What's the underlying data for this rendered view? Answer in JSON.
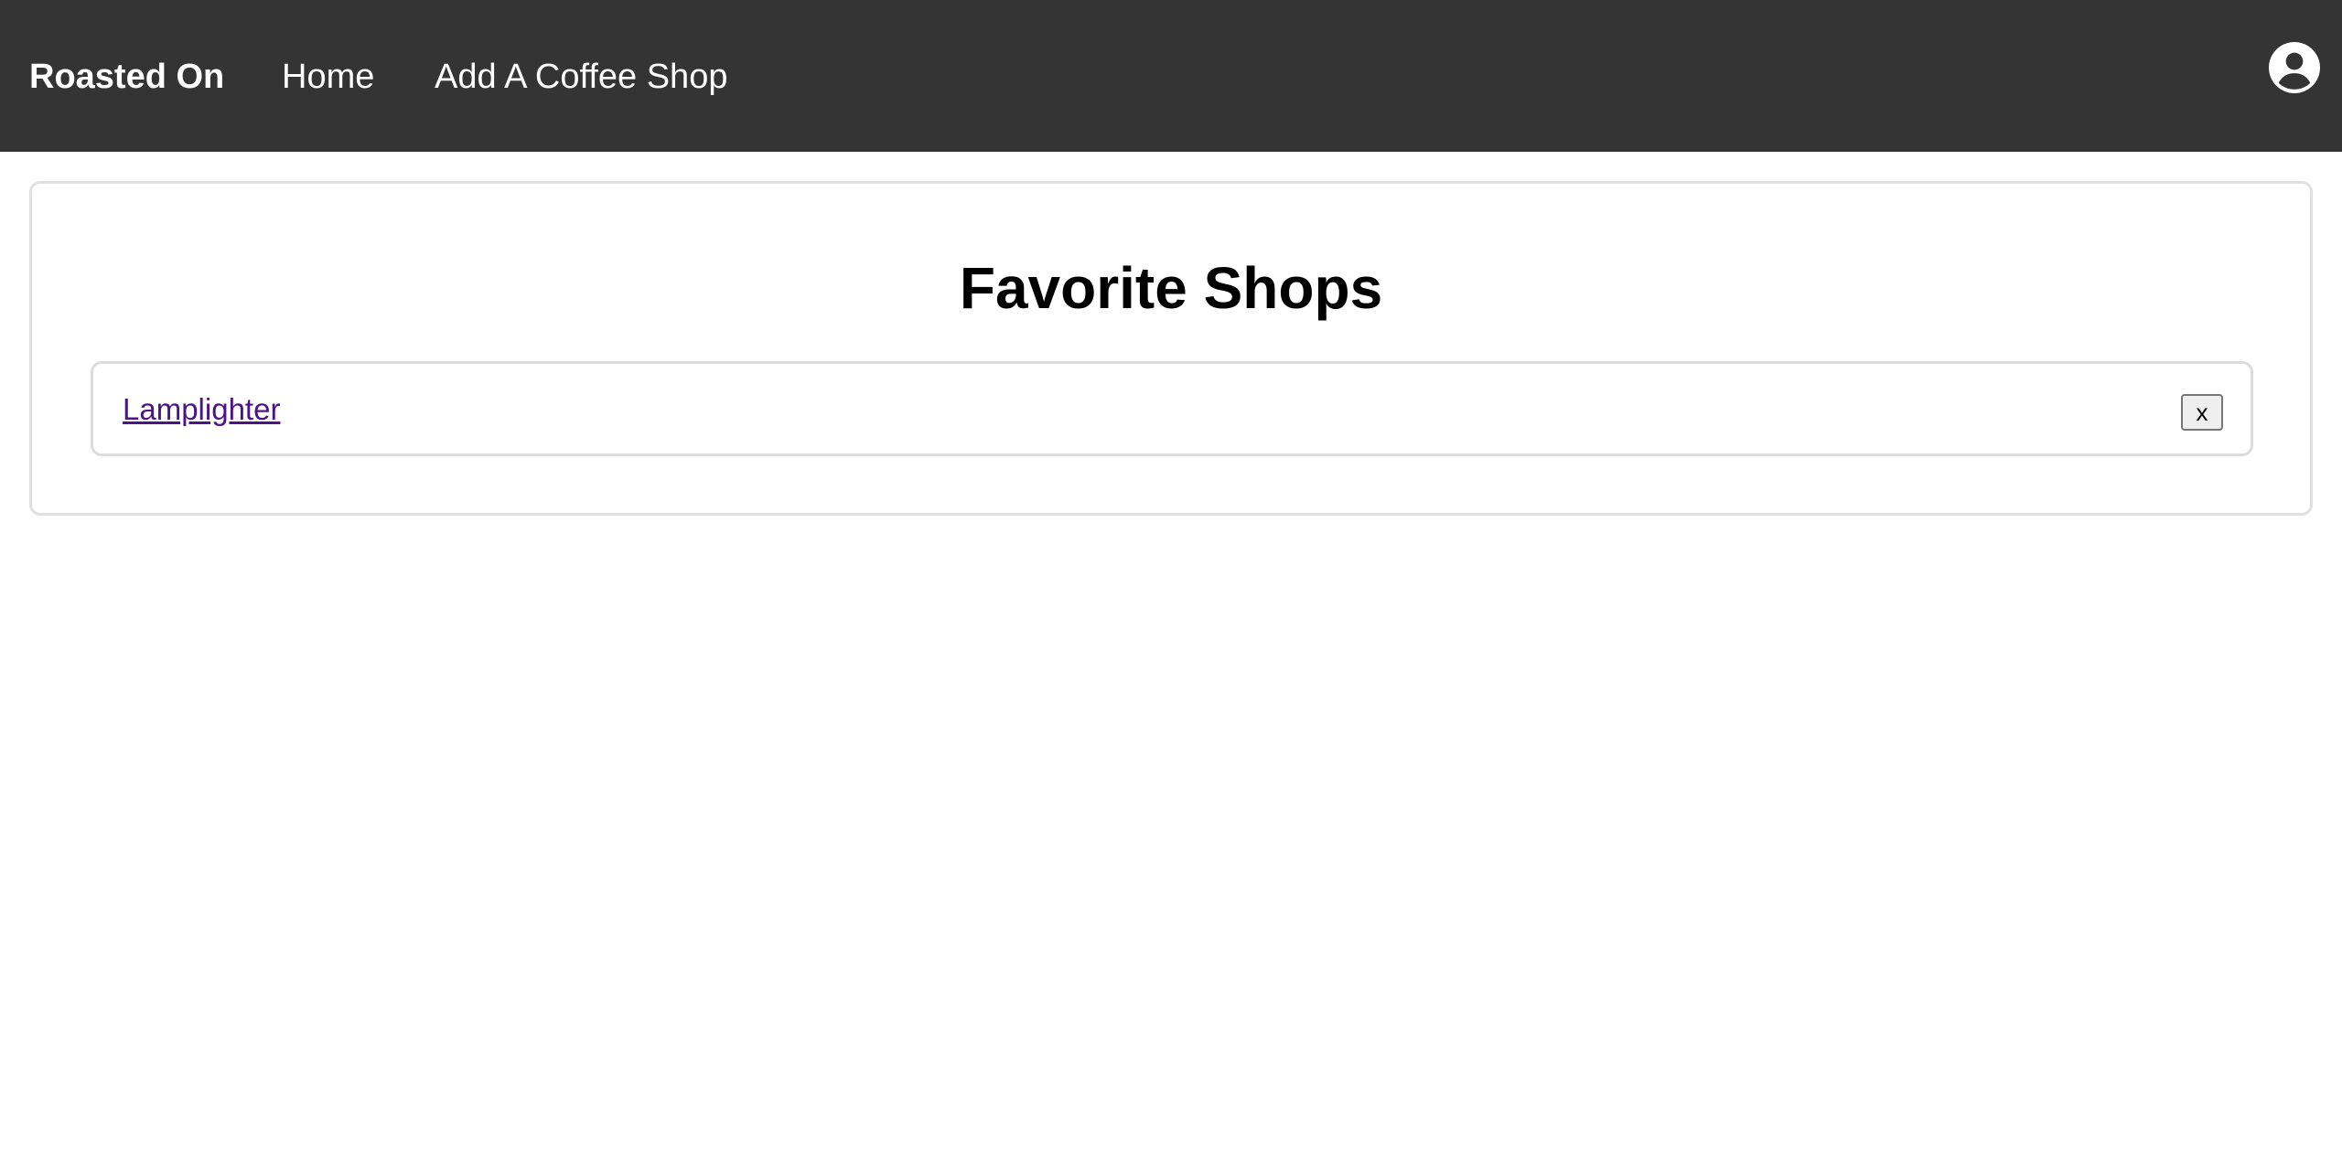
{
  "navbar": {
    "brand": "Roasted On",
    "links": [
      {
        "label": "Home"
      },
      {
        "label": "Add A Coffee Shop"
      }
    ],
    "account_icon": "account-circle-icon",
    "background_color": "#343434"
  },
  "main": {
    "title": "Favorite Shops",
    "shops": [
      {
        "name": "Lamplighter",
        "remove_label": "x"
      }
    ]
  },
  "colors": {
    "link_visited": "#4b1487",
    "border": "#e0e0e0"
  }
}
